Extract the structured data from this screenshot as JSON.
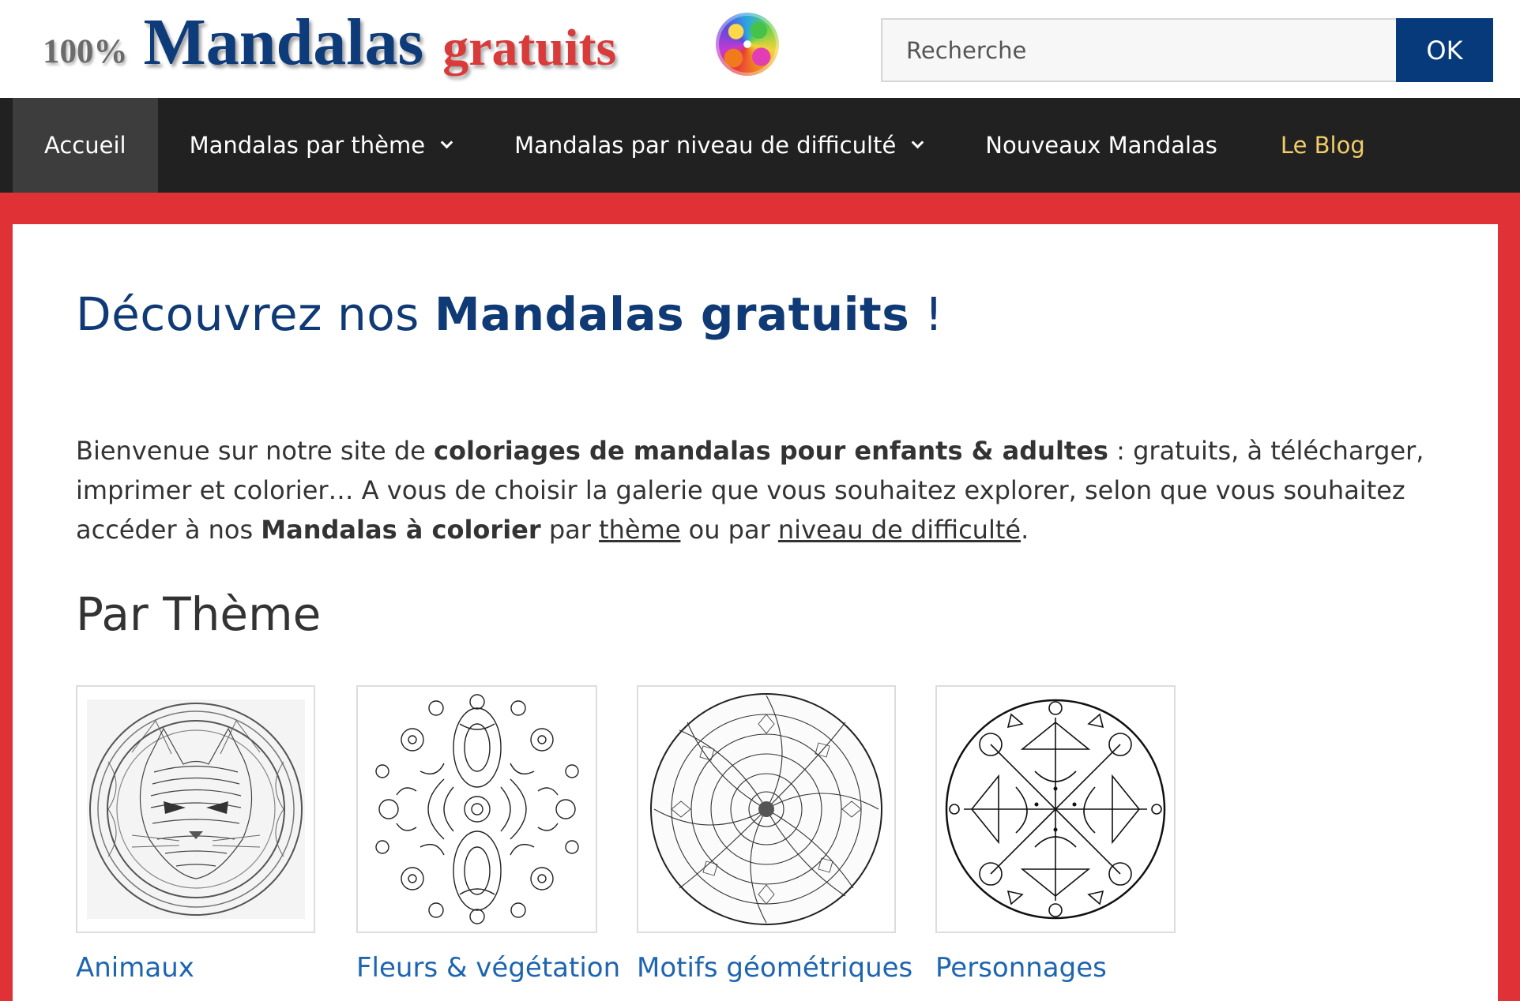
{
  "header": {
    "logo": {
      "part_100": "100%",
      "part_main": "Mandalas",
      "part_accent": "gratuits"
    },
    "search": {
      "placeholder": "Recherche",
      "button_label": "OK"
    }
  },
  "nav": {
    "items": [
      {
        "label": "Accueil",
        "active": true,
        "dropdown": false
      },
      {
        "label": "Mandalas par thème",
        "active": false,
        "dropdown": true
      },
      {
        "label": "Mandalas par niveau de difficulté",
        "active": false,
        "dropdown": true
      },
      {
        "label": "Nouveaux Mandalas",
        "active": false,
        "dropdown": false
      },
      {
        "label": "Le Blog",
        "active": false,
        "dropdown": false
      }
    ]
  },
  "main": {
    "title_prefix": "Découvrez nos ",
    "title_bold": "Mandalas gratuits",
    "title_suffix": " !",
    "intro": {
      "t1": "Bienvenue sur notre site de ",
      "b1": "coloriages de mandalas pour enfants & adultes",
      "t2": " : gratuits, à télécharger, imprimer et colorier… A vous de choisir la galerie que vous souhaitez explorer, selon que vous souhaitez accéder à nos ",
      "b2": "Mandalas à colorier",
      "t3": " par ",
      "link1": "thème",
      "t4": " ou par ",
      "link2": "niveau de difficulté",
      "t5": "."
    },
    "section_title": "Par Thème",
    "themes": [
      {
        "label": "Animaux",
        "icon": "cat-mandala-icon"
      },
      {
        "label": "Fleurs & végétation",
        "icon": "flower-mandala-icon"
      },
      {
        "label": "Motifs géométriques",
        "icon": "geometric-mandala-icon"
      },
      {
        "label": "Personnages",
        "icon": "character-mandala-icon"
      }
    ]
  },
  "colors": {
    "page_background": "#e03236",
    "nav_background": "#212121",
    "nav_active": "#3d3d3d",
    "blog_link": "#f1cd69",
    "brand_blue": "#0f3a75",
    "link_blue": "#1e65b0",
    "button_blue": "#073a7a"
  }
}
